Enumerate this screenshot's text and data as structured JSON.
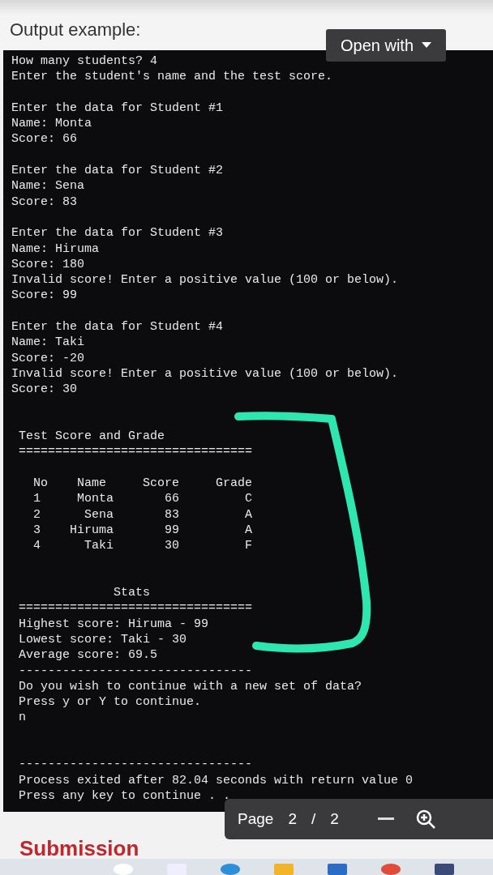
{
  "heading": "Output example:",
  "open_with": {
    "label": "Open with"
  },
  "console": {
    "blocks": [
      {
        "kind": "plain",
        "lines": [
          "How many students? 4",
          "Enter the student's name and the test score."
        ]
      },
      {
        "kind": "plain",
        "lines": [
          "Enter the data for Student #1",
          "Name: Monta",
          "Score: 66"
        ]
      },
      {
        "kind": "plain",
        "lines": [
          "Enter the data for Student #2",
          "Name: Sena",
          "Score: 83"
        ]
      },
      {
        "kind": "plain",
        "lines": [
          "Enter the data for Student #3",
          "Name: Hiruma",
          "Score: 180",
          "Invalid score! Enter a positive value (100 or below).",
          "Score: 99"
        ]
      },
      {
        "kind": "plain",
        "lines": [
          "Enter the data for Student #4",
          "Name: Taki",
          "Score: -20",
          "Invalid score! Enter a positive value (100 or below).",
          "Score: 30"
        ]
      },
      {
        "kind": "spaced",
        "lines": [
          " Test Score and Grade",
          " ================================"
        ]
      },
      {
        "kind": "plain",
        "lines": [
          "   No    Name     Score     Grade",
          "   1     Monta       66         C",
          "   2      Sena       83         A",
          "   3    Hiruma       99         A",
          "   4      Taki       30         F"
        ]
      },
      {
        "kind": "spaced",
        "lines": [
          "              Stats",
          " ================================",
          " Highest score: Hiruma - 99",
          " Lowest score: Taki - 30",
          " Average score: 69.5",
          " --------------------------------",
          " Do you wish to continue with a new set of data?",
          " Press y or Y to continue.",
          " n"
        ]
      },
      {
        "kind": "spaced",
        "lines": [
          " --------------------------------",
          " Process exited after 82.04 seconds with return value 0",
          " Press any key to continue . ."
        ]
      }
    ]
  },
  "page_bar": {
    "label": "Page",
    "current": "2",
    "separator": "/",
    "total": "2"
  },
  "submission": "Submission"
}
